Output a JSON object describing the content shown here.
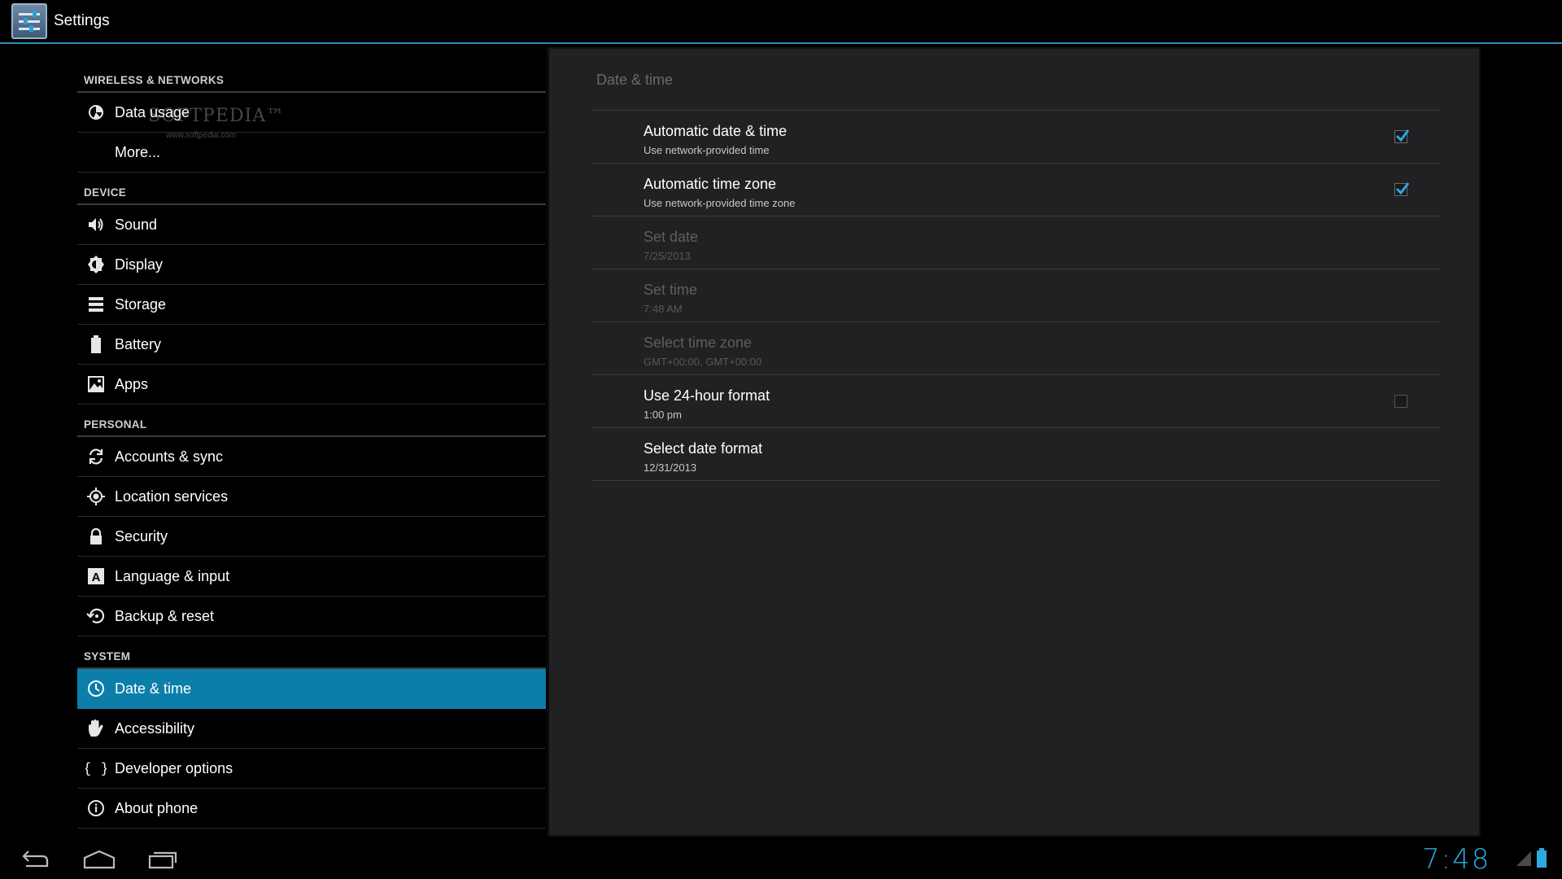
{
  "actionbar": {
    "title": "Settings"
  },
  "watermark": {
    "text": "SOFTPEDIA™",
    "sub": "www.softpedia.com"
  },
  "sidebar": {
    "sections": [
      {
        "header": "WIRELESS & NETWORKS",
        "items": [
          {
            "label": "Data usage",
            "icon": "data-usage-icon"
          },
          {
            "label": "More...",
            "icon": ""
          }
        ]
      },
      {
        "header": "DEVICE",
        "items": [
          {
            "label": "Sound",
            "icon": "speaker-icon"
          },
          {
            "label": "Display",
            "icon": "brightness-icon"
          },
          {
            "label": "Storage",
            "icon": "storage-icon"
          },
          {
            "label": "Battery",
            "icon": "battery-icon"
          },
          {
            "label": "Apps",
            "icon": "apps-icon"
          }
        ]
      },
      {
        "header": "PERSONAL",
        "items": [
          {
            "label": "Accounts & sync",
            "icon": "sync-icon"
          },
          {
            "label": "Location services",
            "icon": "location-icon"
          },
          {
            "label": "Security",
            "icon": "lock-icon"
          },
          {
            "label": "Language & input",
            "icon": "keyboard-letter-icon"
          },
          {
            "label": "Backup & reset",
            "icon": "backup-icon"
          }
        ]
      },
      {
        "header": "SYSTEM",
        "items": [
          {
            "label": "Date & time",
            "icon": "clock-icon",
            "active": true
          },
          {
            "label": "Accessibility",
            "icon": "hand-icon"
          },
          {
            "label": "Developer options",
            "icon": "braces-icon"
          },
          {
            "label": "About phone",
            "icon": "info-icon"
          }
        ]
      }
    ]
  },
  "detail": {
    "title": "Date & time",
    "prefs": [
      {
        "title": "Automatic date & time",
        "summary": "Use network-provided time",
        "checkbox": true,
        "checked": true,
        "enabled": true
      },
      {
        "title": "Automatic time zone",
        "summary": "Use network-provided time zone",
        "checkbox": true,
        "checked": true,
        "enabled": true
      },
      {
        "title": "Set date",
        "summary": "7/25/2013",
        "checkbox": false,
        "enabled": false
      },
      {
        "title": "Set time",
        "summary": "7:48 AM",
        "checkbox": false,
        "enabled": false
      },
      {
        "title": "Select time zone",
        "summary": "GMT+00:00, GMT+00:00",
        "checkbox": false,
        "enabled": false
      },
      {
        "title": "Use 24-hour format",
        "summary": "1:00 pm",
        "checkbox": true,
        "checked": false,
        "enabled": true
      },
      {
        "title": "Select date format",
        "summary": "12/31/2013",
        "checkbox": false,
        "enabled": true
      }
    ]
  },
  "statusbar": {
    "clock": "7:48"
  },
  "colors": {
    "accent": "#2ba9e1",
    "active_row": "#0b7eaa",
    "panel_bg": "#212124"
  }
}
